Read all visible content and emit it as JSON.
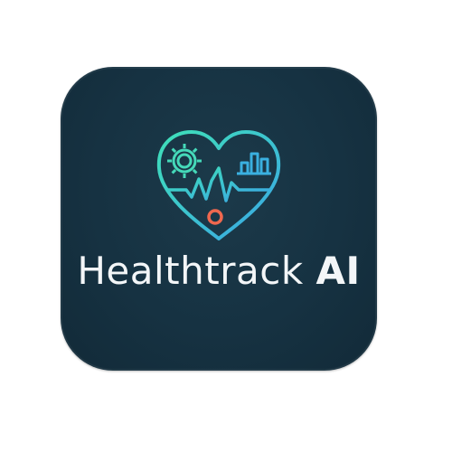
{
  "brand": {
    "name_regular": "Healthtrack ",
    "name_bold": "AI"
  },
  "icons": [
    "heart-outline-icon",
    "heartbeat-line-icon",
    "gear-cog-icon",
    "bar-chart-icon",
    "circle-dot-icon"
  ],
  "colors": {
    "background": "#163242",
    "heart_gradient_start": "#3fe0b8",
    "heart_gradient_end": "#3aa6e6",
    "dot": "#f0684f",
    "text": "#f3f6f8"
  }
}
